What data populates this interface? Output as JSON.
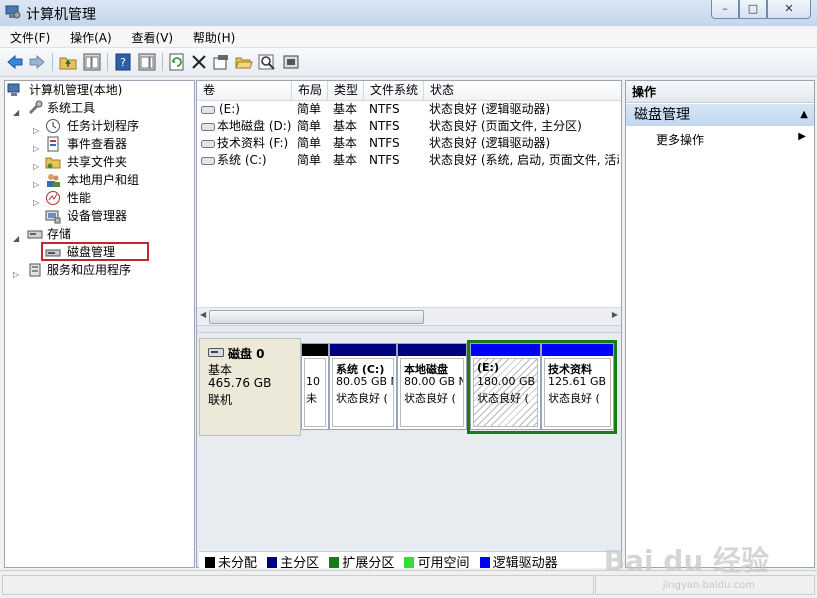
{
  "window": {
    "title": "计算机管理"
  },
  "menu": [
    "文件(F)",
    "操作(A)",
    "查看(V)",
    "帮助(H)"
  ],
  "tree": {
    "root": "计算机管理(本地)",
    "system_tools": "系统工具",
    "task_scheduler": "任务计划程序",
    "event_viewer": "事件查看器",
    "shared_folders": "共享文件夹",
    "local_users": "本地用户和组",
    "performance": "性能",
    "device_manager": "设备管理器",
    "storage": "存储",
    "disk_management": "磁盘管理",
    "services_apps": "服务和应用程序"
  },
  "volumes": {
    "headers": [
      "卷",
      "布局",
      "类型",
      "文件系统",
      "状态"
    ],
    "rows": [
      {
        "name": "(E:)",
        "layout": "简单",
        "type": "基本",
        "fs": "NTFS",
        "status": "状态良好 (逻辑驱动器)"
      },
      {
        "name": "本地磁盘 (D:)",
        "layout": "简单",
        "type": "基本",
        "fs": "NTFS",
        "status": "状态良好 (页面文件, 主分区)"
      },
      {
        "name": "技术资料 (F:)",
        "layout": "简单",
        "type": "基本",
        "fs": "NTFS",
        "status": "状态良好 (逻辑驱动器)"
      },
      {
        "name": "系统 (C:)",
        "layout": "简单",
        "type": "基本",
        "fs": "NTFS",
        "status": "状态良好 (系统, 启动, 页面文件, 活动"
      }
    ]
  },
  "disk": {
    "name": "磁盘 0",
    "type": "基本",
    "size": "465.76 GB",
    "state": "联机",
    "partitions": [
      {
        "line1": "",
        "line2": "10",
        "line3": "未"
      },
      {
        "line1": "系统 (C:)",
        "line2": "80.05 GB N",
        "line3": "状态良好 ("
      },
      {
        "line1": "本地磁盘",
        "line2": "80.00 GB N",
        "line3": "状态良好 ("
      },
      {
        "line1": "(E:)",
        "line2": "180.00 GB",
        "line3": "状态良好 ("
      },
      {
        "line1": "技术资料",
        "line2": "125.61 GB I",
        "line3": "状态良好 ("
      }
    ]
  },
  "legend": [
    "未分配",
    "主分区",
    "扩展分区",
    "可用空间",
    "逻辑驱动器"
  ],
  "colors": {
    "unallocated": "#000000",
    "primary": "#000080",
    "extended": "#1a7a1a",
    "free": "#33dd33",
    "logical": "#0000ff"
  },
  "actions": {
    "header": "操作",
    "selected": "磁盘管理",
    "more": "更多操作"
  },
  "watermark": {
    "brand": "Bai du 经验",
    "url": "jingyan.baidu.com"
  }
}
